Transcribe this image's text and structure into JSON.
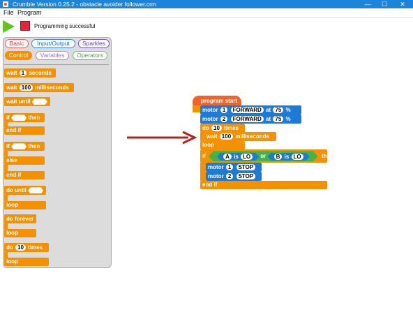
{
  "window": {
    "title": "Crumble Version 0.25.2 - obstacle avoider follower.crm",
    "min": "—",
    "max": "☐",
    "close": "✕"
  },
  "menu": {
    "file": "File",
    "program": "Program"
  },
  "toolbar": {
    "status": "Programming successful",
    "play_icon": "play-icon",
    "stop_icon": "stop-icon"
  },
  "categories": {
    "basic": "Basic",
    "io": "Input/Output",
    "sparkles": "Sparkles",
    "control": "Control",
    "variables": "Variables",
    "operators": "Operators"
  },
  "colors": {
    "title_bar": "#1b86d9",
    "control": "#f39100",
    "motor": "#1e7ad4",
    "hat": "#f0642a",
    "condition": "#46b24a",
    "arrow": "#b22418",
    "play": "#5fc61c",
    "stop": "#e3243b"
  },
  "palette": {
    "wait": "wait",
    "one": "1",
    "seconds": "seconds",
    "hundred": "100",
    "milliseconds": "milliseconds",
    "wait_until": "wait until",
    "if": "if",
    "then": "then",
    "end_if": "end if",
    "else": "else",
    "do_until": "do until",
    "loop": "loop",
    "do_forever": "do forever",
    "do": "do",
    "ten": "10",
    "times": "times"
  },
  "script": {
    "program_start": "program start",
    "motor": "motor",
    "m1": "1",
    "m2": "2",
    "forward": "FORWARD",
    "at": "at",
    "speed": "75",
    "percent": "%",
    "do": "do",
    "count": "10",
    "times": "times",
    "wait": "wait",
    "ms": "100",
    "milliseconds": "milliseconds",
    "loop": "loop",
    "if": "if",
    "a": "A",
    "is": "is",
    "lo": "LO",
    "or": "or",
    "b": "B",
    "then": "then",
    "stop": "STOP",
    "end_if": "end if"
  }
}
